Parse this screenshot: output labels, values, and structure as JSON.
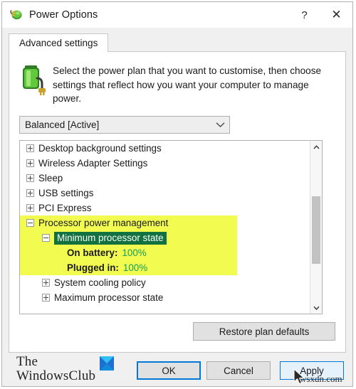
{
  "window": {
    "title": "Power Options",
    "icon": "power-plan-icon",
    "help_label": "?",
    "close_label": "✕"
  },
  "tabs": [
    {
      "label": "Advanced settings",
      "selected": true
    }
  ],
  "header": {
    "icon": "battery-plug-icon",
    "description": "Select the power plan that you want to customise, then choose settings that reflect how you want your computer to manage power."
  },
  "plan_select": {
    "value": "Balanced [Active]",
    "arrow_icon": "chevron-down-icon"
  },
  "tree": {
    "rows": [
      {
        "label": "Desktop background settings",
        "indent": 0,
        "expander": "plus",
        "style": "normal"
      },
      {
        "label": "Wireless Adapter Settings",
        "indent": 0,
        "expander": "plus",
        "style": "normal"
      },
      {
        "label": "Sleep",
        "indent": 0,
        "expander": "plus",
        "style": "normal"
      },
      {
        "label": "USB settings",
        "indent": 0,
        "expander": "plus",
        "style": "normal"
      },
      {
        "label": "PCI Express",
        "indent": 0,
        "expander": "plus",
        "style": "normal"
      },
      {
        "label": "Processor power management",
        "indent": 0,
        "expander": "minus",
        "style": "highlight"
      },
      {
        "label": "Minimum processor state",
        "indent": 1,
        "expander": "minus",
        "style": "selected"
      },
      {
        "label": "On battery:",
        "value": "100%",
        "indent": 2,
        "expander": "none",
        "style": "value"
      },
      {
        "label": "Plugged in:",
        "value": "100%",
        "indent": 2,
        "expander": "none",
        "style": "value"
      },
      {
        "label": "System cooling policy",
        "indent": 1,
        "expander": "plus",
        "style": "normal"
      },
      {
        "label": "Maximum processor state",
        "indent": 1,
        "expander": "plus",
        "style": "normal"
      }
    ],
    "scrollbar": {
      "up_icon": "chevron-up-icon",
      "down_icon": "chevron-down-icon"
    }
  },
  "restore_button": {
    "label": "Restore plan defaults"
  },
  "footer": {
    "logo_line1": "The",
    "logo_line2": "WindowsClub",
    "logo_mark": "windowsclub-diamond-icon",
    "buttons": {
      "ok": "OK",
      "cancel": "Cancel",
      "apply": "Apply"
    },
    "watermark": "wsxdn.com"
  },
  "colors": {
    "highlight_yellow": "#f2fb50",
    "selection_green": "#11713f",
    "value_green": "#12a05a",
    "focus_blue": "#0078d7"
  }
}
